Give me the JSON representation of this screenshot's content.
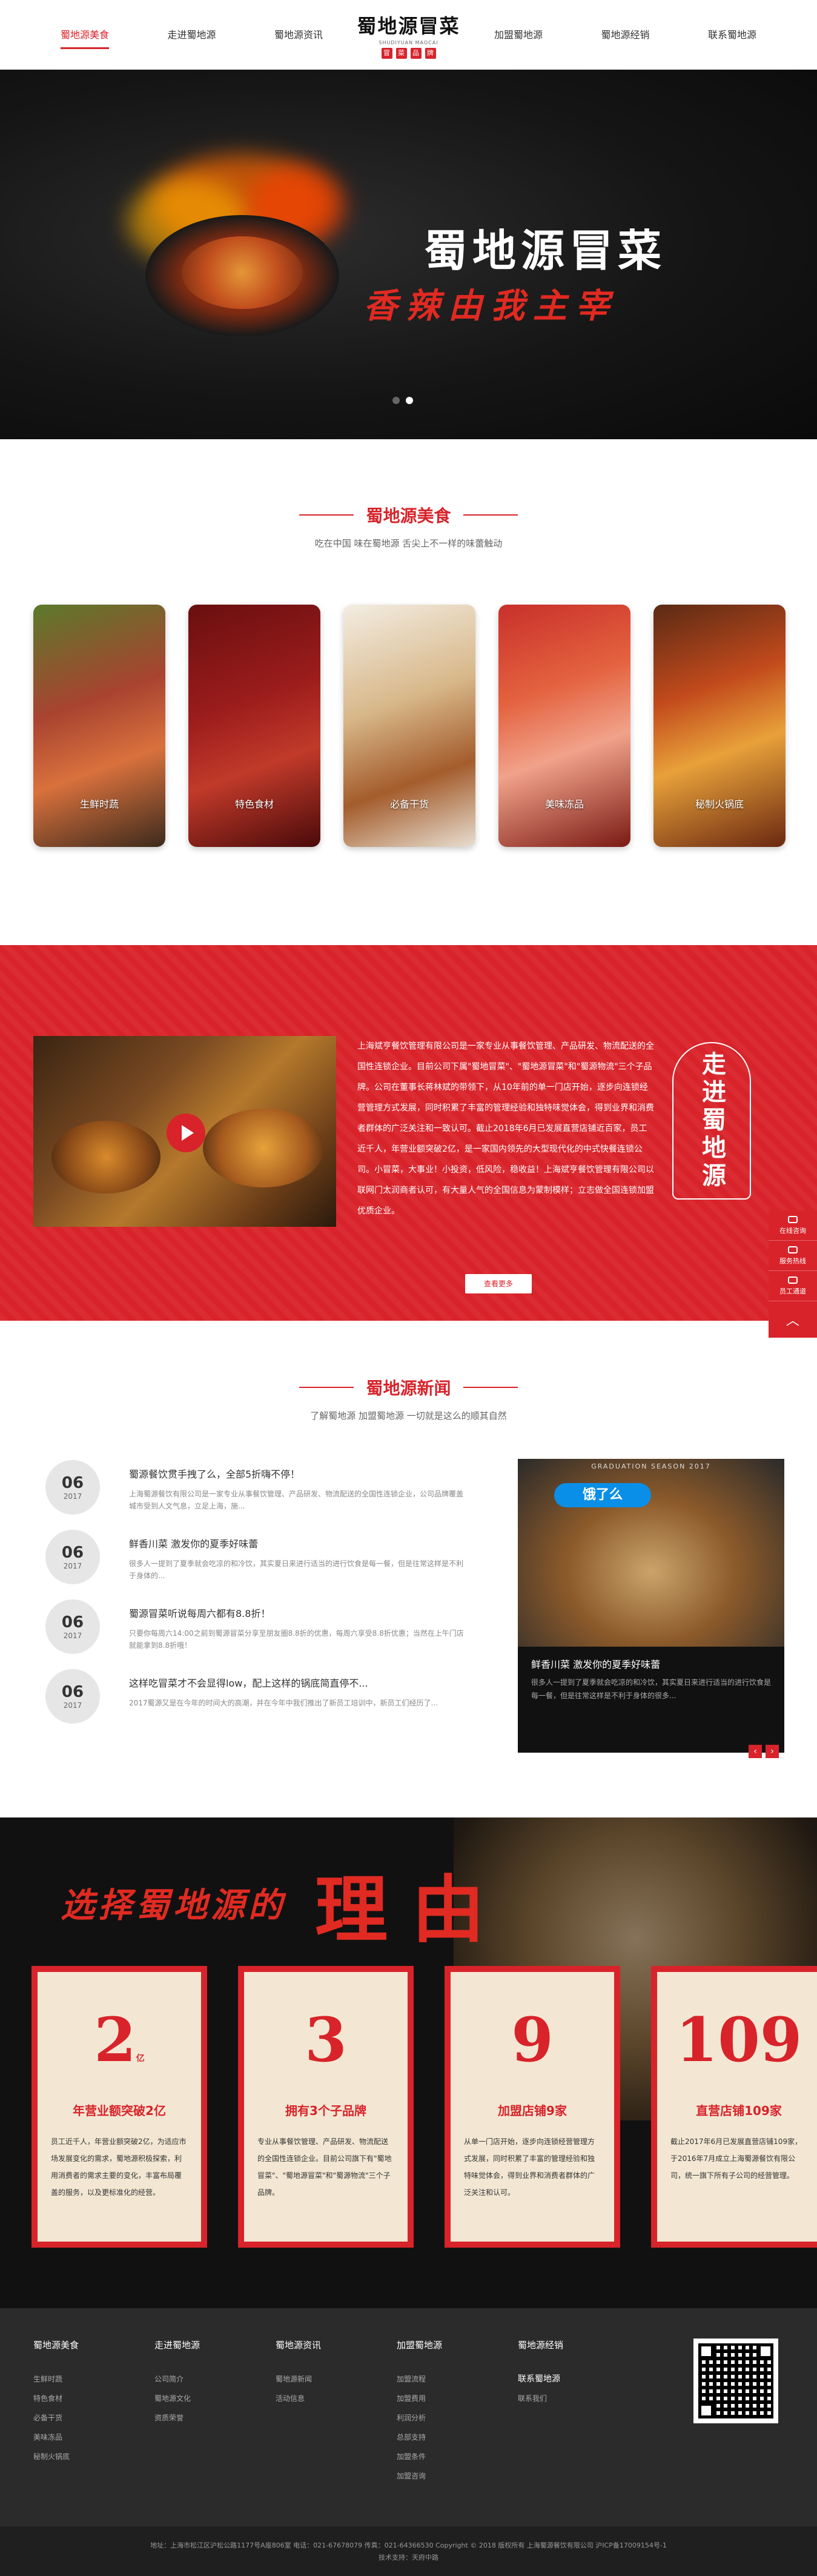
{
  "nav": {
    "left": [
      "蜀地源美食",
      "走进蜀地源",
      "蜀地源资讯"
    ],
    "right": [
      "加盟蜀地源",
      "蜀地源经销",
      "联系蜀地源"
    ],
    "logo": "蜀地源冒菜",
    "logo_sub": "SHUDIYUAN MAOCAI",
    "logo_badges": [
      "冒",
      "菜",
      "品",
      "牌"
    ]
  },
  "banner": {
    "slogan1": "蜀地源冒菜",
    "slogan2": "香辣由我主宰"
  },
  "food": {
    "title": "蜀地源美食",
    "subtitle": "吃在中国 味在蜀地源 舌尖上不一样的味蕾触动",
    "cards": [
      "生鲜时蔬",
      "特色食材",
      "必备干货",
      "美味冻品",
      "秘制火锅底"
    ]
  },
  "about": {
    "text": "上海斌亨餐饮管理有限公司是一家专业从事餐饮管理、产品研发、物流配送的全国性连锁企业。目前公司下属\"蜀地冒菜\"、\"蜀地源冒菜\"和\"蜀源物流\"三个子品牌。公司在董事长蒋林斌的带领下，从10年前的单一门店开始，逐步向连锁经营管理方式发展，同时积累了丰富的管理经验和独特味觉体会，得到业界和消费者群体的广泛关注和一致认可。截止2018年6月已发展直营店铺近百家，员工近千人，年营业额突破2亿，是一家国内领先的大型现代化的中式快餐连锁公司。小冒菜，大事业！小投资，低风险，稳收益！上海斌亨餐饮管理有限公司以联网门太润商者认可，有大量人气的全国信息为蒙制模样；立志做全国连锁加盟优质企业。",
    "more": "查看更多",
    "seal": "走进蜀地源"
  },
  "float": {
    "items": [
      "在线咨询",
      "服务热线",
      "员工通道"
    ],
    "up": "︿"
  },
  "news": {
    "title": "蜀地源新闻",
    "subtitle": "了解蜀地源 加盟蜀地源 一切就是这么的顺其自然",
    "items": [
      {
        "day": "06",
        "year": "2017",
        "title": "蜀源餐饮贯手拽了么，全部5折嗨不停！",
        "desc": "上海蜀源餐饮有限公司是一家专业从事餐饮管理、产品研发、物流配送的全国性连锁企业，公司品牌覆盖城市受到人文气息，立足上海，施..."
      },
      {
        "day": "06",
        "year": "2017",
        "title": "鲜香川菜 激发你的夏季好味蕾",
        "desc": "很多人一提到了夏季就会吃凉的和冷饮，其实夏日来进行适当的进行饮食是每一餐，但是往常这样是不利于身体的..."
      },
      {
        "day": "06",
        "year": "2017",
        "title": "蜀源冒菜听说每周六都有8.8折！",
        "desc": "只要你每周六14:00之前到蜀源冒菜分享至朋友圈8.8折的优惠，每周六享受8.8折优惠；当然在上午门店就能拿到8.8折哦！"
      },
      {
        "day": "06",
        "year": "2017",
        "title": "这样吃冒菜才不会显得low，配上这样的锅底简直停不...",
        "desc": "2017蜀源又是在今年的时间大的高潮，并在今年中我们推出了新员工培训中，新员工们经历了..."
      }
    ],
    "feature": {
      "grad": "GRADUATION SEASON 2017",
      "badge": "饿了么",
      "title": "鲜香川菜 激发你的夏季好味蕾",
      "desc": "很多人一提到了夏季就会吃凉的和冷饮，其实夏日来进行适当的进行饮食是每一餐，但是往常这样是不利于身体的很多..."
    }
  },
  "reasons": {
    "title1": "选择蜀地源的",
    "title2": "理由",
    "cards": [
      {
        "num": "2",
        "unit": "亿",
        "title": "年营业额突破2亿",
        "desc": "员工近千人，年营业额突破2亿，为适应市场发展变化的需求，蜀地源积极探索，利用消费者的需求主要的变化，丰富布局覆盖的服务，以及更标准化的经营。"
      },
      {
        "num": "3",
        "unit": "",
        "title": "拥有3个子品牌",
        "desc": "专业从事餐饮管理、产品研发、物流配送的全国性连锁企业。目前公司旗下有\"蜀地冒菜\"、\"蜀地源冒菜\"和\"蜀源物流\"三个子品牌。"
      },
      {
        "num": "9",
        "unit": "",
        "title": "加盟店铺9家",
        "desc": "从单一门店开始，逐步向连锁经营管理方式发展，同时积累了丰富的管理经验和独特味觉体会，得到业界和消费者群体的广泛关注和认可。"
      },
      {
        "num": "109",
        "unit": "",
        "title": "直营店铺109家",
        "desc": "截止2017年6月已发展直营店铺109家，于2016年7月成立上海蜀源餐饮有限公司，统一旗下所有子公司的经营管理。"
      }
    ]
  },
  "footer": {
    "cols": [
      {
        "title": "蜀地源美食",
        "links": [
          "生鲜时蔬",
          "特色食材",
          "必备干货",
          "美味冻品",
          "秘制火锅底"
        ]
      },
      {
        "title": "走进蜀地源",
        "links": [
          "公司简介",
          "蜀地源文化",
          "资质荣誉"
        ]
      },
      {
        "title": "蜀地源资讯",
        "links": [
          "蜀地源新闻",
          "活动信息"
        ]
      },
      {
        "title": "加盟蜀地源",
        "links": [
          "加盟流程",
          "加盟费用",
          "利润分析",
          "总部支持",
          "加盟条件",
          "加盟咨询"
        ]
      },
      {
        "title": "蜀地源经销",
        "links": [
          "联系蜀地源"
        ]
      },
      {
        "title": "",
        "links": [
          "联系我们"
        ]
      }
    ],
    "copyright1": "地址：上海市松江区沪松公路1177号A座806室   电话：021-67678079   传真：021-64366530   Copyright © 2018 版权所有 上海蜀源餐饮有限公司  沪ICP备17009154号-1",
    "copyright2": "技术支持：天府中路"
  }
}
